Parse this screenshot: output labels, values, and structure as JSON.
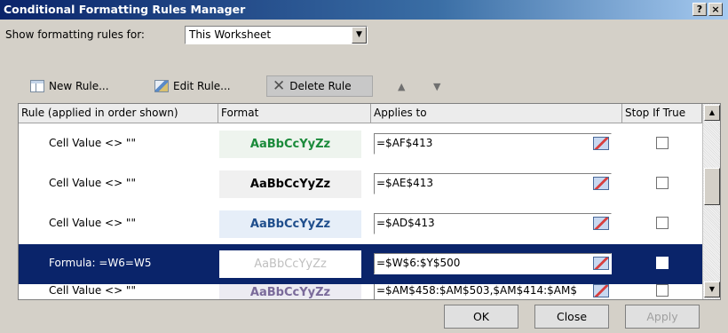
{
  "window": {
    "title": "Conditional Formatting Rules Manager",
    "help_label": "?",
    "close_label": "×"
  },
  "show_rules": {
    "label": "Show formatting rules for:",
    "selected": "This Worksheet",
    "arrow": "▼"
  },
  "toolbar": {
    "new_rule": "New Rule...",
    "edit_rule": "Edit Rule...",
    "delete_rule": "Delete Rule",
    "move_up": "▲",
    "move_down": "▼"
  },
  "columns": {
    "rule": "Rule (applied in order shown)",
    "format": "Format",
    "applies_to": "Applies to",
    "stop_if_true": "Stop If True"
  },
  "rules": [
    {
      "rule": "Cell Value <> \"\"",
      "preview": "AaBbCcYyZz",
      "applies_to": "=$AF$413",
      "preview_color": "#1a8a3a",
      "preview_bg": "#eef4ee"
    },
    {
      "rule": "Cell Value <> \"\"",
      "preview": "AaBbCcYyZz",
      "applies_to": "=$AE$413",
      "preview_color": "#000000",
      "preview_bg": "#f0f0f0"
    },
    {
      "rule": "Cell Value <> \"\"",
      "preview": "AaBbCcYyZz",
      "applies_to": "=$AD$413",
      "preview_color": "#1f4e8c",
      "preview_bg": "#e6eef8"
    },
    {
      "rule": "Formula: =W6=W5",
      "preview": "AaBbCcYyZz",
      "applies_to": "=$W$6:$Y$500",
      "preview_color": "#c0c0c0",
      "preview_bg": "#ffffff"
    },
    {
      "rule": "Cell Value <> \"\"",
      "preview": "AaBbCcYyZz",
      "applies_to": "=$AM$458:$AM$503,$AM$414:$AM$",
      "preview_color": "#7a6a9a",
      "preview_bg": "#ecebf2"
    }
  ],
  "scrollbar": {
    "up": "▲",
    "down": "▼"
  },
  "buttons": {
    "ok": "OK",
    "close": "Close",
    "apply": "Apply"
  }
}
